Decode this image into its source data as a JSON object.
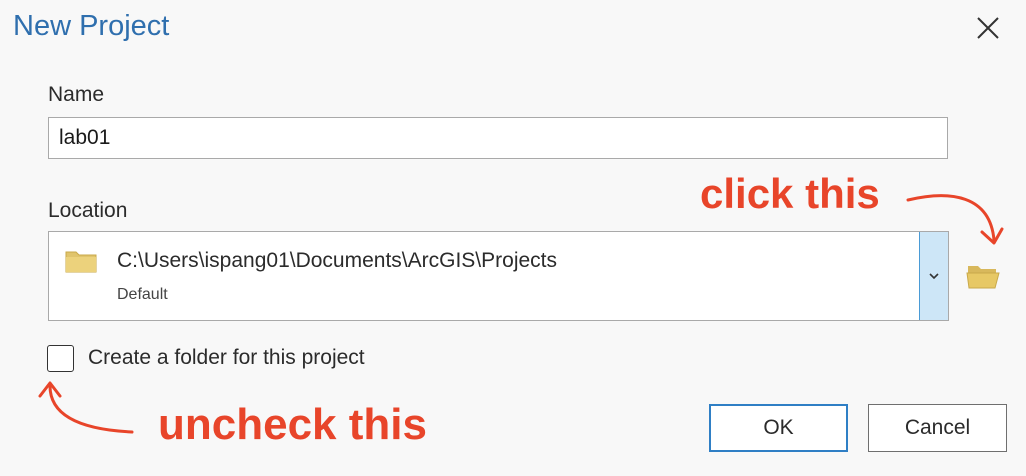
{
  "dialog": {
    "title": "New Project"
  },
  "name_field": {
    "label": "Name",
    "value": "lab01"
  },
  "location_field": {
    "label": "Location",
    "path": "C:\\Users\\ispang01\\Documents\\ArcGIS\\Projects",
    "sublabel": "Default"
  },
  "create_folder": {
    "label": "Create a folder for this project",
    "checked": false
  },
  "buttons": {
    "ok": "OK",
    "cancel": "Cancel"
  },
  "annotations": {
    "click_this": "click this",
    "uncheck_this": "uncheck this",
    "color": "#e8452a"
  },
  "colors": {
    "title": "#2f6fae",
    "folder": "#e0c46c",
    "dropdown_bg": "#cde6f7",
    "ok_border": "#2f7fc5"
  },
  "icons": [
    "close-icon",
    "folder-icon",
    "chevron-down-icon",
    "folder-open-icon"
  ]
}
